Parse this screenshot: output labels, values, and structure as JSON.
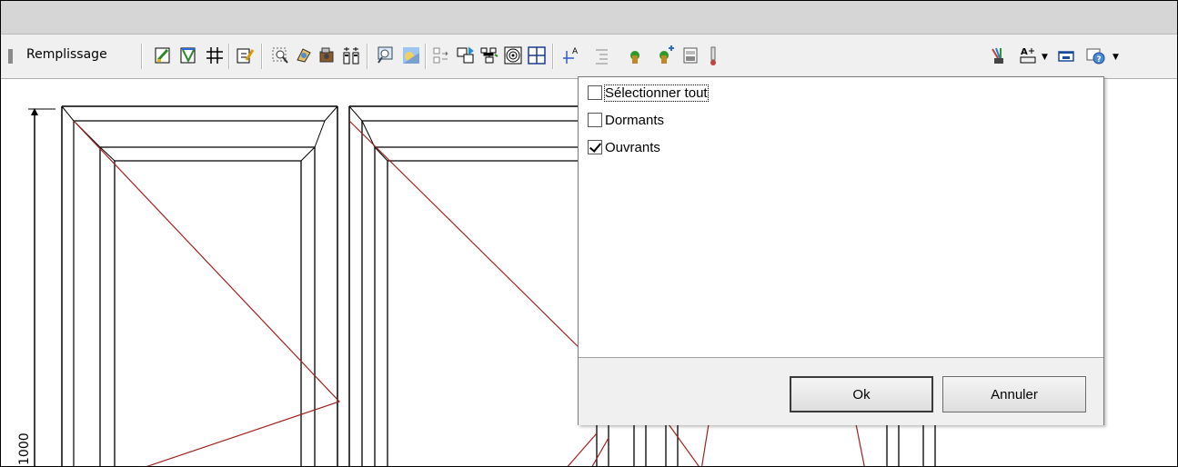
{
  "toolbar": {
    "remplissage_label": "Remplissage",
    "icons": [
      "fill-color-icon",
      "eraser-icon",
      "grid-icon",
      "edit-pencil-icon",
      "zoom-select-icon",
      "rotate-object-icon",
      "camera-icon",
      "columns-icon",
      "zoom-preview-icon",
      "sky-icon",
      "split-icon",
      "insert-frame-icon",
      "branch-icon",
      "circle-target-icon",
      "table-grid-icon",
      "dimension-arrow-icon",
      "list-indent-icon",
      "tree-icon",
      "tree-add-icon",
      "window-view-icon",
      "thermometer-icon",
      "brush-icon",
      "text-format-icon",
      "window-icon",
      "help-icon"
    ]
  },
  "drawing": {
    "dimension_value": "1000"
  },
  "popup": {
    "items": [
      {
        "label": "Sélectionner tout",
        "checked": false
      },
      {
        "label": "Dormants",
        "checked": false
      },
      {
        "label": "Ouvrants",
        "checked": true
      }
    ],
    "ok_label": "Ok",
    "cancel_label": "Annuler"
  }
}
